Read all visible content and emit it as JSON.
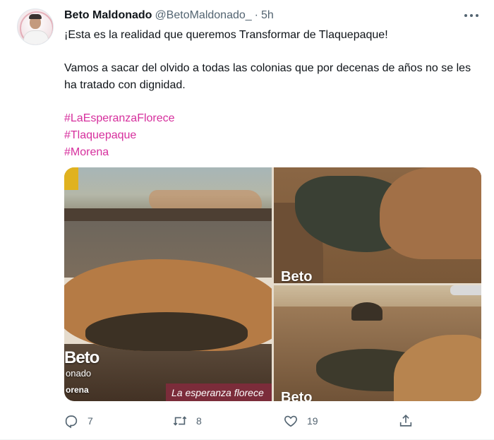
{
  "tweet": {
    "author_name": "Beto Maldonado",
    "handle": "@BetoMaldonado_",
    "separator": "·",
    "time": "5h",
    "paragraph1": "¡Esta es la realidad que queremos Transformar de Tlaquepaque!",
    "paragraph2": "Vamos a sacar del olvido a todas las colonias que por decenas de años no se les ha tratado con dignidad.",
    "hashtags": [
      "#LaEsperanzaFlorece",
      "#Tlaquepaque",
      "#Morena"
    ],
    "hashtag_color": "#d62f9d"
  },
  "media": {
    "photo1": {
      "brand_text": "Beto",
      "brand_sub": "onado",
      "brand_tag": "orena",
      "caption": "La esperanza florece"
    },
    "photo2": {
      "brand_text": "Beto"
    },
    "photo3": {
      "brand_text": "Beto"
    }
  },
  "actions": {
    "reply": {
      "icon": "reply-icon",
      "count": "7"
    },
    "retweet": {
      "icon": "retweet-icon",
      "count": "8"
    },
    "like": {
      "icon": "heart-icon",
      "count": "19"
    },
    "share": {
      "icon": "share-icon",
      "count": ""
    }
  },
  "menu_icon": "more-icon"
}
